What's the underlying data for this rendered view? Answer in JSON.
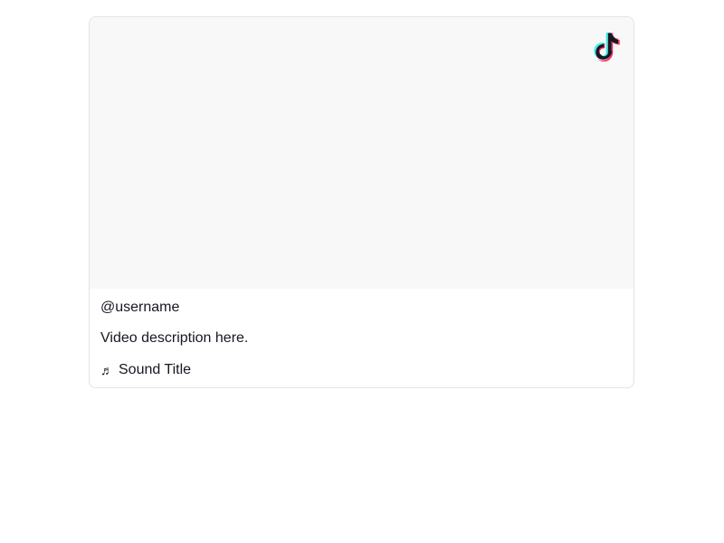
{
  "embed": {
    "brand_icon": "tiktok-logo-icon",
    "username": "@username",
    "description": "Video description here.",
    "sound": {
      "icon": "music-note-icon",
      "glyph": "♬",
      "title": "Sound Title"
    }
  },
  "colors": {
    "text": "#161823",
    "video_background": "#f8f8f8",
    "border": "#e3e3e3",
    "logo_cyan": "#25f4ee",
    "logo_red": "#fe2c55",
    "logo_dark": "#161823"
  }
}
